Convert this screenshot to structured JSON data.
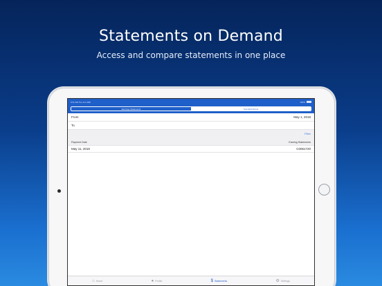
{
  "marketing": {
    "headline": "Statements on Demand",
    "subheadline": "Access and compare statements in one place"
  },
  "statusbar": {
    "left": "9:41 AM   Tue Jun 26th",
    "right": "100%"
  },
  "segments": [
    {
      "label": "Earnings Statements",
      "active": true
    },
    {
      "label": "Year End Forms",
      "active": false
    }
  ],
  "filters": {
    "from_label": "From",
    "from_value": "May 1, 2018",
    "to_label": "To",
    "to_value": ""
  },
  "filter_link": "Filter",
  "table": {
    "columns": [
      "Payment Date",
      "Earning Statements"
    ],
    "rows": [
      [
        "May 11, 2018",
        "C0051720"
      ]
    ]
  },
  "tabbar": [
    {
      "label": "Home",
      "icon": "home-icon",
      "active": false
    },
    {
      "label": "Profile",
      "icon": "profile-icon",
      "active": false
    },
    {
      "label": "Statements",
      "icon": "dollar-icon",
      "active": true
    },
    {
      "label": "Settings",
      "icon": "gear-icon",
      "active": false
    }
  ],
  "colors": {
    "accent": "#1f5fc9",
    "link": "#3b7bd6"
  }
}
